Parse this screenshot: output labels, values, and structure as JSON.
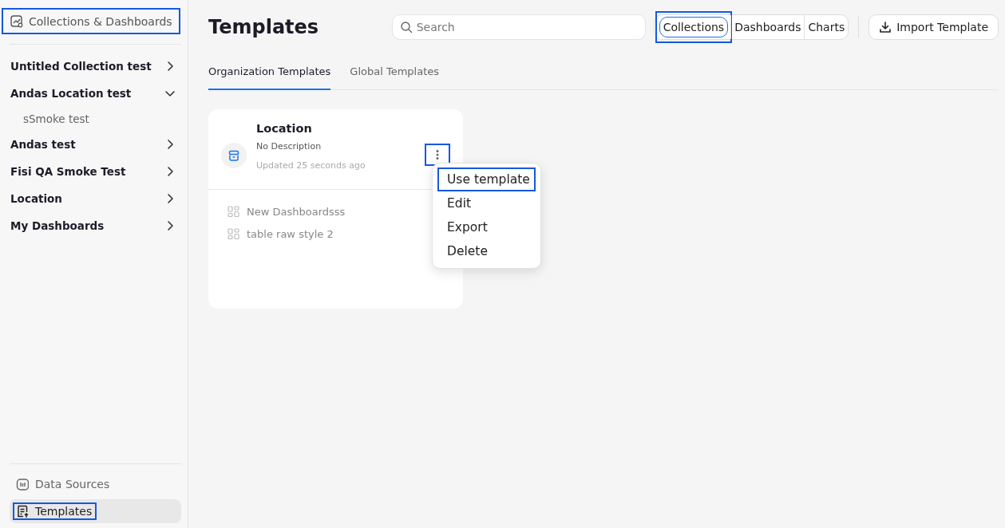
{
  "sidebar": {
    "header": {
      "label": "Collections & Dashboards",
      "highlighted": true
    },
    "items": [
      {
        "label": "Untitled Collection test",
        "expanded": false
      },
      {
        "label": "Andas Location test",
        "expanded": true,
        "children": [
          {
            "label": "sSmoke test"
          }
        ]
      },
      {
        "label": "Andas test",
        "expanded": false
      },
      {
        "label": "Fisi QA Smoke Test",
        "expanded": false
      },
      {
        "label": "Location",
        "expanded": false
      },
      {
        "label": "My Dashboards",
        "expanded": false
      }
    ],
    "footer_items": [
      {
        "label": "Data Sources",
        "kind": "sources",
        "selected": false,
        "highlighted": false
      },
      {
        "label": "Templates",
        "kind": "templates",
        "selected": true,
        "highlighted": true
      }
    ]
  },
  "header": {
    "title": "Templates",
    "search": {
      "placeholder": "Search"
    },
    "segments": [
      {
        "label": "Collections",
        "selected": true,
        "highlighted": true
      },
      {
        "label": "Dashboards",
        "selected": false,
        "highlighted": false
      },
      {
        "label": "Charts",
        "selected": false,
        "highlighted": false
      }
    ],
    "import_button": "Import Template"
  },
  "tabs": [
    {
      "label": "Organization Templates",
      "selected": true
    },
    {
      "label": "Global Templates",
      "selected": false
    }
  ],
  "cards": [
    {
      "title": "Location",
      "description": "No Description",
      "updated": "Updated 25 seconds ago",
      "more_button": {
        "highlighted": true
      },
      "dashboards": [
        "New Dashboardsss",
        "table raw style 2"
      ],
      "menu": [
        {
          "label": "Use template",
          "highlighted": true
        },
        {
          "label": "Edit",
          "highlighted": false
        },
        {
          "label": "Export",
          "highlighted": false
        },
        {
          "label": "Delete",
          "highlighted": false
        }
      ]
    }
  ]
}
